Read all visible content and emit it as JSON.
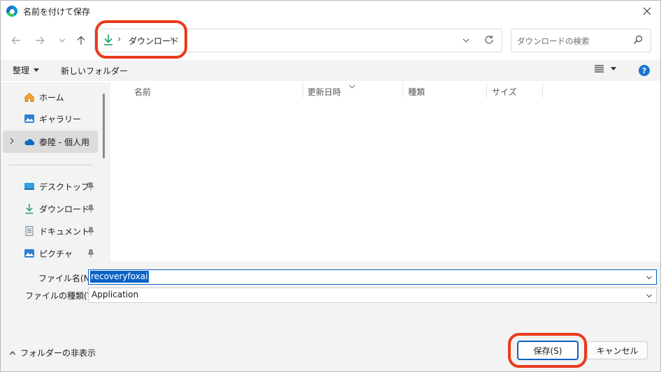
{
  "window": {
    "title": "名前を付けて保存"
  },
  "address": {
    "crumb": "ダウンロード"
  },
  "search": {
    "placeholder": "ダウンロードの検索"
  },
  "toolbar": {
    "organize_label": "整理",
    "new_folder_label": "新しいフォルダー"
  },
  "sidebar": {
    "items": [
      {
        "label": "ホーム",
        "icon": "home-icon"
      },
      {
        "label": "ギャラリー",
        "icon": "gallery-icon"
      },
      {
        "label": "泰陸 - 個人用",
        "icon": "onedrive-cloud-icon"
      },
      {
        "label": "デスクトップ",
        "icon": "desktop-icon",
        "pinned": true
      },
      {
        "label": "ダウンロード",
        "icon": "download-icon",
        "pinned": true
      },
      {
        "label": "ドキュメント",
        "icon": "document-icon",
        "pinned": true
      },
      {
        "label": "ピクチャ",
        "icon": "pictures-icon",
        "pinned": true
      }
    ]
  },
  "file_list": {
    "columns": [
      "名前",
      "更新日時",
      "種類",
      "サイズ"
    ]
  },
  "form": {
    "filename_label": "ファイル名(N):",
    "filename_value": "recoveryfoxai",
    "filetype_label": "ファイルの種類(T):",
    "filetype_value": "Application"
  },
  "footer": {
    "hide_folders_label": "フォルダーの非表示",
    "save_label": "保存(S)",
    "cancel_label": "キャンセル"
  },
  "colors": {
    "highlight": "#ea3a1c",
    "accent": "#0b63c5",
    "download_green": "#1a9d6c"
  }
}
